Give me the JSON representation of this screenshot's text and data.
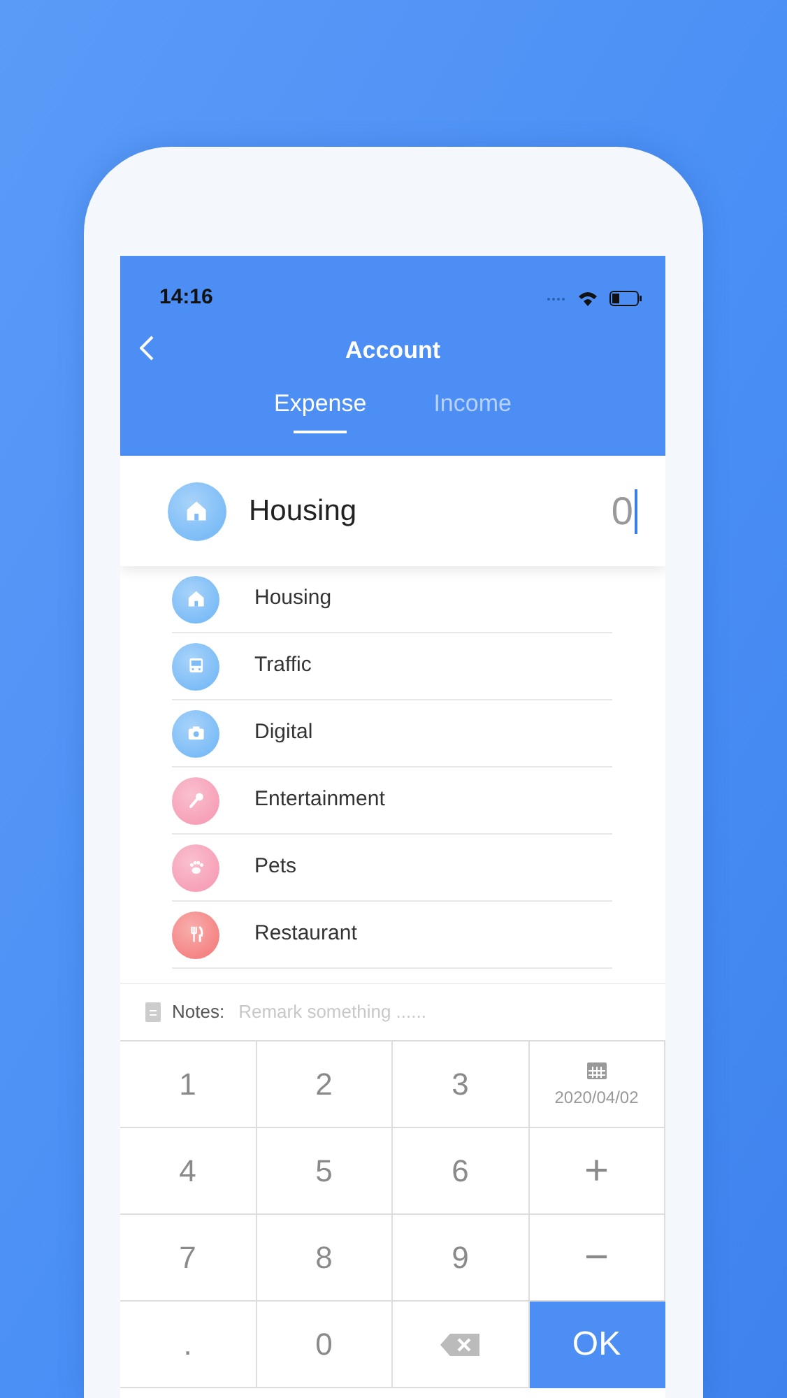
{
  "status_bar": {
    "time": "14:16"
  },
  "nav": {
    "title": "Account"
  },
  "tabs": [
    {
      "label": "Expense",
      "selected": true
    },
    {
      "label": "Income",
      "selected": false
    }
  ],
  "current": {
    "kind": "house",
    "color": "#7dbdf7",
    "name": "Housing",
    "value": "0"
  },
  "categories": [
    {
      "kind": "house",
      "color": "#7dbdf7",
      "name": "Housing"
    },
    {
      "kind": "bus",
      "color": "#7dbdf7",
      "name": "Traffic"
    },
    {
      "kind": "camera",
      "color": "#7dbdf7",
      "name": "Digital"
    },
    {
      "kind": "microphone",
      "color": "#f7a1b8",
      "name": "Entertainment"
    },
    {
      "kind": "paw",
      "color": "#f7a1b8",
      "name": "Pets"
    },
    {
      "kind": "cutlery",
      "color": "#f58585",
      "name": "Restaurant"
    }
  ],
  "notes": {
    "label": "Notes:",
    "placeholder": "Remark something ......"
  },
  "keypad": [
    {
      "kind": "digit",
      "label": "1"
    },
    {
      "kind": "digit",
      "label": "2"
    },
    {
      "kind": "digit",
      "label": "3"
    },
    {
      "kind": "date",
      "label": "2020/04/02"
    },
    {
      "kind": "digit",
      "label": "4"
    },
    {
      "kind": "digit",
      "label": "5"
    },
    {
      "kind": "digit",
      "label": "6"
    },
    {
      "kind": "operator",
      "label": "+"
    },
    {
      "kind": "digit",
      "label": "7"
    },
    {
      "kind": "digit",
      "label": "8"
    },
    {
      "kind": "digit",
      "label": "9"
    },
    {
      "kind": "operator",
      "label": "−"
    },
    {
      "kind": "digit",
      "label": "."
    },
    {
      "kind": "digit",
      "label": "0"
    },
    {
      "kind": "backspace"
    },
    {
      "kind": "ok",
      "label": "OK"
    }
  ]
}
